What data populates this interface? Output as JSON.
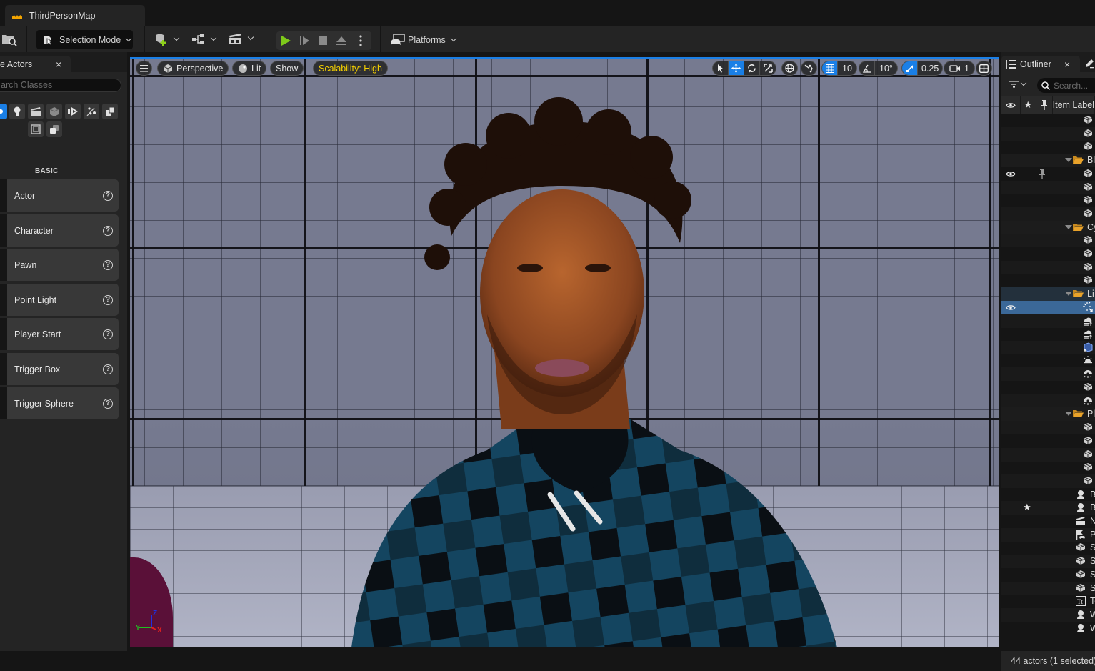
{
  "window": {
    "document_tab": "ThirdPersonMap"
  },
  "toolbar": {
    "selection_mode": "Selection Mode",
    "platforms": "Platforms",
    "play_color": "#7ec91a"
  },
  "place_actors": {
    "tab_label": "e Actors",
    "close": "×",
    "search_placeholder": "arch Classes",
    "category_icons": [
      "basic-icon",
      "lights-icon",
      "cinematic-icon",
      "visual-effects-icon",
      "geometry-icon",
      "volumes-icon",
      "all-classes-icon",
      "shapes-icon",
      "recently-placed-icon"
    ],
    "section_label": "BASIC",
    "items": [
      {
        "label": "Actor"
      },
      {
        "label": "Character"
      },
      {
        "label": "Pawn"
      },
      {
        "label": "Point Light"
      },
      {
        "label": "Player Start"
      },
      {
        "label": "Trigger Box"
      },
      {
        "label": "Trigger Sphere"
      }
    ],
    "help_glyph": "?"
  },
  "viewport": {
    "perspective": "Perspective",
    "lit": "Lit",
    "show": "Show",
    "scalability": "Scalability: High",
    "scalability_color": "#f5d000",
    "grid_snap": "10",
    "rotation_snap": "10°",
    "scale_snap": "0.25",
    "camera_speed": "1",
    "accent": "#1a7fe6",
    "axis": {
      "x": "X",
      "y": "Y",
      "z": "Z"
    }
  },
  "outliner": {
    "tab_label": "Outliner",
    "close": "×",
    "search_placeholder": "Search...",
    "header": {
      "item_label": "Item Label"
    },
    "rows": [
      {
        "type": "mesh",
        "label": ""
      },
      {
        "type": "mesh",
        "label": ""
      },
      {
        "type": "mesh",
        "label": ""
      },
      {
        "type": "folder",
        "label": "Bl"
      },
      {
        "type": "mesh",
        "label": "",
        "eye": true,
        "pin": true
      },
      {
        "type": "mesh",
        "label": ""
      },
      {
        "type": "mesh",
        "label": ""
      },
      {
        "type": "mesh",
        "label": ""
      },
      {
        "type": "folder",
        "label": "Cy"
      },
      {
        "type": "mesh",
        "label": ""
      },
      {
        "type": "mesh",
        "label": ""
      },
      {
        "type": "mesh",
        "label": ""
      },
      {
        "type": "mesh",
        "label": ""
      },
      {
        "type": "folder",
        "label": "Li",
        "highlight": true
      },
      {
        "type": "light",
        "label": "",
        "eye": true,
        "selected": true
      },
      {
        "type": "cloud",
        "label": ""
      },
      {
        "type": "cloud",
        "label": ""
      },
      {
        "type": "volume",
        "label": ""
      },
      {
        "type": "sky",
        "label": ""
      },
      {
        "type": "skylight",
        "label": ""
      },
      {
        "type": "mesh",
        "label": ""
      },
      {
        "type": "skylight",
        "label": ""
      },
      {
        "type": "folder",
        "label": "Pl"
      },
      {
        "type": "mesh",
        "label": ""
      },
      {
        "type": "mesh",
        "label": ""
      },
      {
        "type": "mesh",
        "label": ""
      },
      {
        "type": "mesh",
        "label": ""
      },
      {
        "type": "mesh",
        "label": ""
      },
      {
        "type": "pawn",
        "label": "BP"
      },
      {
        "type": "pawn",
        "label": "BP",
        "star": true
      },
      {
        "type": "clapper",
        "label": "Ne"
      },
      {
        "type": "playerstart",
        "label": "Pl"
      },
      {
        "type": "mesh",
        "label": "SM"
      },
      {
        "type": "mesh",
        "label": "SM"
      },
      {
        "type": "mesh",
        "label": "SM"
      },
      {
        "type": "mesh",
        "label": "SM"
      },
      {
        "type": "text",
        "label": "Te"
      },
      {
        "type": "pawn",
        "label": "W"
      },
      {
        "type": "pawn",
        "label": "W"
      }
    ],
    "status": "44 actors (1 selected)"
  }
}
